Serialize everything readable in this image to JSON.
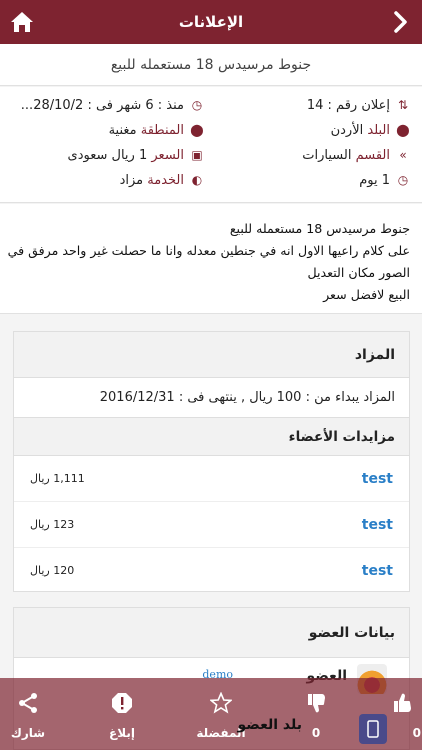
{
  "header": {
    "title": "الإعلانات"
  },
  "ad_title": "جنوط مرسيدس 18 مستعمله للبيع",
  "info": {
    "since": "منذ : 6 شهر فى : 28/10/2...",
    "ad_number": "إعلان رقم : 14",
    "country_label": "البلد",
    "country_value": "الأردن",
    "region_label": "المنطقة",
    "region_value": "مغنية",
    "section_label": "القسم",
    "section_value": "السيارات",
    "price_label": "السعر",
    "price_value": "1 ريال سعودى",
    "service_label": "الخدمة",
    "service_value": "مزاد",
    "duration": "1 يوم"
  },
  "description": [
    "جنوط مرسيدس 18 مستعمله للبيع",
    "على كلام راعيها الاول انه في جنطين معدله وانا ما حصلت غير واحد مرفق في",
    "الصور مكان التعديل",
    "البيع لافضل سعر"
  ],
  "auction": {
    "header": "المزاد",
    "detail": "المزاد يبداء من : 100 ريال , ينتهى فى : 2016/12/31",
    "bids_header": "مزايدات الأعضاء",
    "bids": [
      {
        "user": "test",
        "amount": "1,111 ريال"
      },
      {
        "user": "test",
        "amount": "123 ريال"
      },
      {
        "user": "test",
        "amount": "120 ريال"
      }
    ]
  },
  "member": {
    "header": "بيانات العضو",
    "member_label": "العضو",
    "member_value": "demo",
    "country_label": "بلد العضو"
  },
  "bottom_bar": {
    "like_count": "0",
    "dislike_count": "0",
    "favorite": "المفضلة",
    "report": "إبلاغ",
    "share": "شارك"
  },
  "colors": {
    "primary": "#7e2330",
    "link": "#2a7fc7"
  },
  "icons": [
    "home-icon",
    "back-chevron-icon",
    "sort-number-icon",
    "clock-icon",
    "map-pin-icon",
    "cash-icon",
    "toggle-icon",
    "category-icon",
    "share-icon",
    "alert-icon",
    "star-icon",
    "thumbs-down-icon",
    "thumbs-up-icon",
    "mobile-icon"
  ]
}
